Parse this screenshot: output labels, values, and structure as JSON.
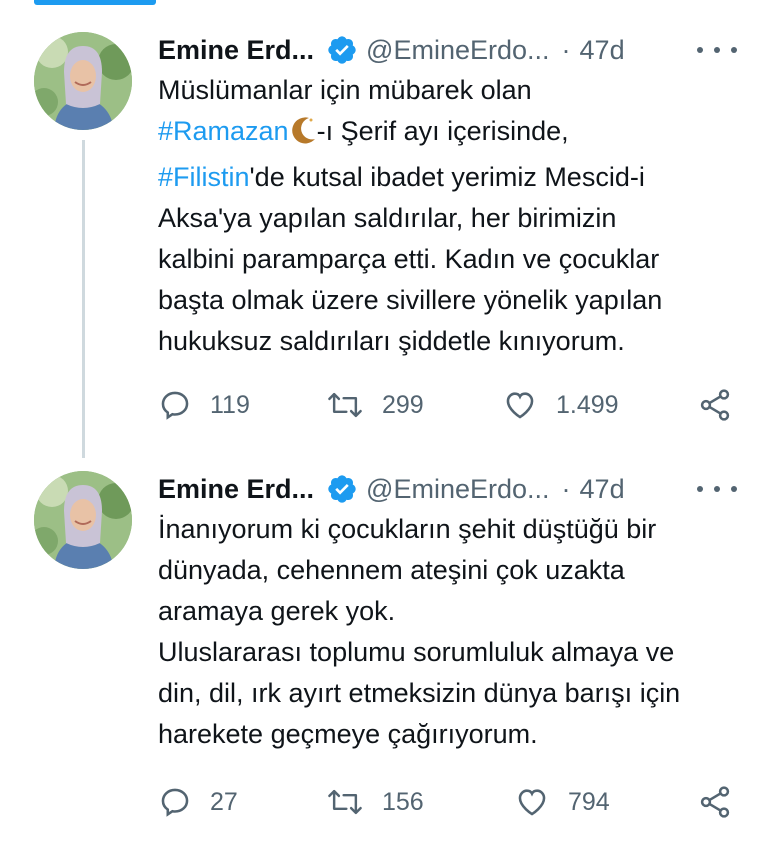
{
  "tweets": [
    {
      "name": "Emine Erd...",
      "handle": "@EmineErdo...",
      "time": "47d",
      "separator": "·",
      "text_lines": [
        {
          "type": "plain",
          "text": "Müslümanlar için mübarek olan"
        },
        {
          "type": "hashtag_mixed",
          "hashtag": "#Ramazan",
          "emoji": "crescent-moon",
          "rest": "-ı Şerif ayı içerisinde,"
        },
        {
          "type": "hashtag_mixed",
          "hashtag": "#Filistin",
          "rest": "'de kutsal ibadet yerimiz Mescid-i"
        },
        {
          "type": "plain",
          "text": "Aksa'ya yapılan saldırılar, her birimizin"
        },
        {
          "type": "plain",
          "text": "kalbini paramparça etti. Kadın ve çocuklar"
        },
        {
          "type": "plain",
          "text": "başta olmak üzere sivillere yönelik yapılan"
        },
        {
          "type": "plain",
          "text": "hukuksuz saldırıları şiddetle kınıyorum."
        }
      ],
      "replies": "119",
      "retweets": "299",
      "likes": "1.499"
    },
    {
      "name": "Emine Erd...",
      "handle": "@EmineErdo...",
      "time": "47d",
      "separator": "·",
      "text_lines": [
        {
          "type": "plain",
          "text": "İnanıyorum ki çocukların şehit düştüğü bir"
        },
        {
          "type": "plain",
          "text": "dünyada, cehennem ateşini çok uzakta"
        },
        {
          "type": "plain",
          "text": "aramaya gerek yok."
        },
        {
          "type": "plain",
          "text": "Uluslararası toplumu sorumluluk almaya ve"
        },
        {
          "type": "plain",
          "text": "din, dil, ırk ayırt etmeksizin dünya barışı için"
        },
        {
          "type": "plain",
          "text": "harekete geçmeye çağırıyorum."
        }
      ],
      "replies": "27",
      "retweets": "156",
      "likes": "794"
    }
  ],
  "colors": {
    "accent": "#1d9bf0",
    "text": "#0f1419",
    "secondary": "#536471",
    "thread_line": "#cfd9de"
  },
  "icons": [
    "verified-badge-icon",
    "more-icon",
    "reply-icon",
    "retweet-icon",
    "like-icon",
    "share-icon",
    "crescent-moon-icon"
  ]
}
